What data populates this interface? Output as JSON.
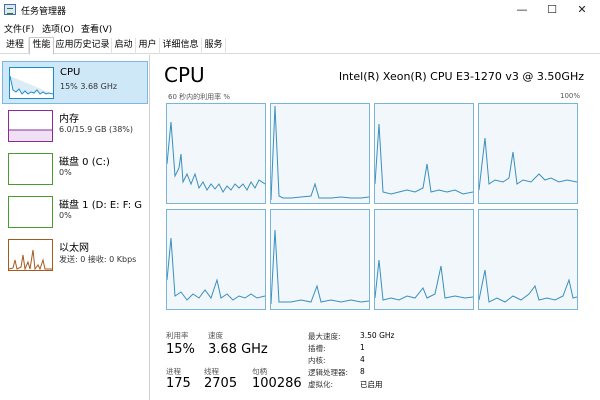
{
  "window": {
    "title": "任务管理器",
    "minimize_glyph": "—",
    "maximize_glyph": "☐",
    "close_glyph": "✕"
  },
  "menu": {
    "file": "文件(F)",
    "options": "选项(O)",
    "view": "查看(V)"
  },
  "tabs": [
    {
      "label": "进程"
    },
    {
      "label": "性能"
    },
    {
      "label": "应用历史记录"
    },
    {
      "label": "启动"
    },
    {
      "label": "用户"
    },
    {
      "label": "详细信息"
    },
    {
      "label": "服务"
    }
  ],
  "active_tab": "性能",
  "sidebar": {
    "items": [
      {
        "name": "CPU",
        "sub": "15% 3.68 GHz",
        "color": "#1a8ccc",
        "icon": "cpu-graph"
      },
      {
        "name": "内存",
        "sub": "6.0/15.9 GB (38%)",
        "color": "#8b2b9b",
        "icon": "memory-graph"
      },
      {
        "name": "磁盘 0 (C:)",
        "sub": "0%",
        "color": "#4b9a2c",
        "icon": "disk-graph"
      },
      {
        "name": "磁盘 1 (D: E: F: G",
        "sub": "0%",
        "color": "#4b9a2c",
        "icon": "disk-graph"
      },
      {
        "name": "以太网",
        "sub": "发送: 0 接收: 0 Kbps",
        "color": "#a65a1e",
        "icon": "network-graph"
      }
    ]
  },
  "main": {
    "title": "CPU",
    "cpu_model": "Intel(R) Xeon(R) CPU E3-1270 v3 @ 3.50GHz",
    "graph_caption": "60 秒内的利用率 %",
    "graph_max": "100%",
    "core_count_shown": 8,
    "graph_color": "#1a8ccc",
    "stats": {
      "utilization_label": "利用率",
      "utilization": "15%",
      "speed_label": "速度",
      "speed": "3.68 GHz",
      "processes_label": "进程",
      "processes": "175",
      "threads_label": "线程",
      "threads": "2705",
      "handles_label": "句柄",
      "handles": "100286"
    },
    "details": [
      {
        "label": "最大速度:",
        "value": "3.50 GHz"
      },
      {
        "label": "插槽:",
        "value": "1"
      },
      {
        "label": "内核:",
        "value": "4"
      },
      {
        "label": "逻辑处理器:",
        "value": "8"
      },
      {
        "label": "虚拟化:",
        "value": "已启用"
      }
    ]
  }
}
